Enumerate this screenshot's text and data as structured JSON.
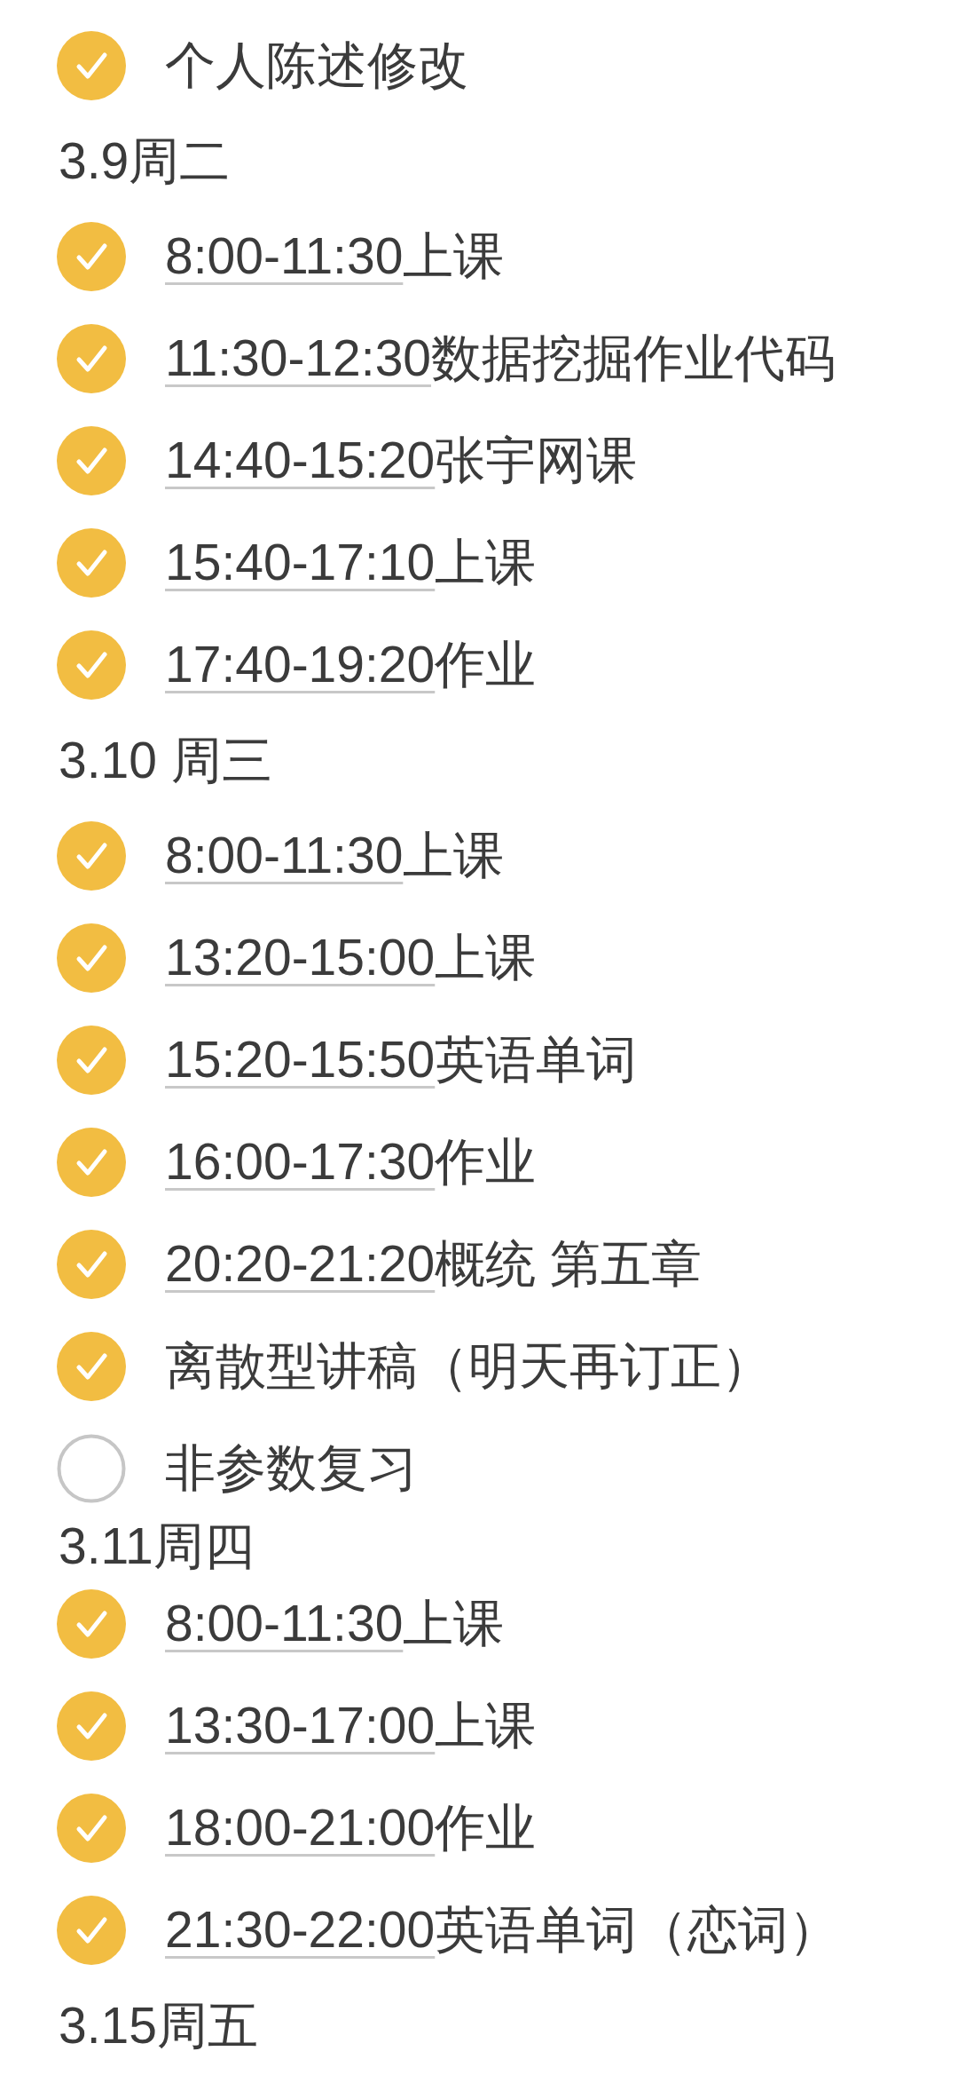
{
  "lines": [
    {
      "kind": "task",
      "checked": true,
      "text": "个人陈述修改"
    },
    {
      "kind": "heading",
      "text": "3.9周二"
    },
    {
      "kind": "task",
      "checked": true,
      "time": "8:00-11:30",
      "text": "上课"
    },
    {
      "kind": "task",
      "checked": true,
      "time": "11:30-12:30",
      "text": "数据挖掘作业代码"
    },
    {
      "kind": "task",
      "checked": true,
      "time": "14:40-15:20",
      "text": "张宇网课"
    },
    {
      "kind": "task",
      "checked": true,
      "time": "15:40-17:10",
      "text": "上课"
    },
    {
      "kind": "task",
      "checked": true,
      "time": "17:40-19:20",
      "text": "作业"
    },
    {
      "kind": "heading",
      "text": "3.10 周三"
    },
    {
      "kind": "task",
      "checked": true,
      "time": "8:00-11:30",
      "text": "上课"
    },
    {
      "kind": "task",
      "checked": true,
      "time": "13:20-15:00",
      "text": "上课"
    },
    {
      "kind": "task",
      "checked": true,
      "time": "15:20-15:50",
      "text": "英语单词"
    },
    {
      "kind": "task",
      "checked": true,
      "time": "16:00-17:30",
      "text": "作业"
    },
    {
      "kind": "task",
      "checked": true,
      "time": "20:20-21:20",
      "text": "概统 第五章"
    },
    {
      "kind": "task",
      "checked": true,
      "text": "离散型讲稿（明天再订正）"
    },
    {
      "kind": "task",
      "checked": false,
      "text": "非参数复习"
    },
    {
      "kind": "heading",
      "text": "3.11周四"
    },
    {
      "kind": "task",
      "checked": true,
      "time": "8:00-11:30",
      "text": "上课"
    },
    {
      "kind": "task",
      "checked": true,
      "time": "13:30-17:00",
      "text": "上课"
    },
    {
      "kind": "task",
      "checked": true,
      "time": "18:00-21:00",
      "text": "作业"
    },
    {
      "kind": "task",
      "checked": true,
      "time": "21:30-22:00",
      "text": "英语单词（恋词）"
    },
    {
      "kind": "heading",
      "text": "3.15周五"
    }
  ]
}
